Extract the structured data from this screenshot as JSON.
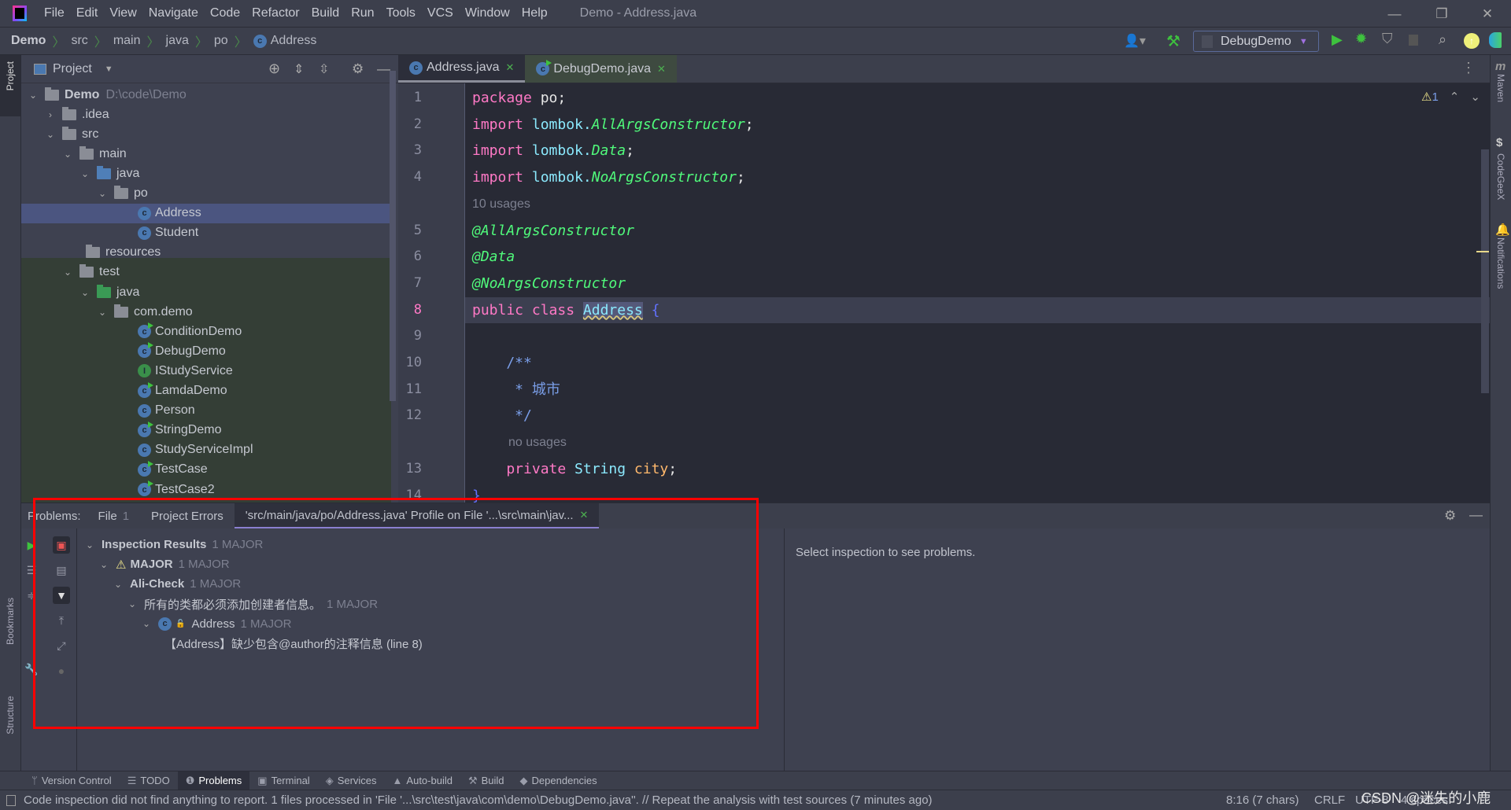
{
  "menubar": {
    "items": [
      "File",
      "Edit",
      "View",
      "Navigate",
      "Code",
      "Refactor",
      "Build",
      "Run",
      "Tools",
      "VCS",
      "Window",
      "Help"
    ],
    "window_title": "Demo - Address.java"
  },
  "breadcrumb": [
    "Demo",
    "src",
    "main",
    "java",
    "po",
    "Address"
  ],
  "toolbar": {
    "run_config": "DebugDemo"
  },
  "project": {
    "title": "Project",
    "tree": [
      {
        "label": "Demo",
        "extra": "D:\\code\\Demo",
        "depth": 0,
        "icon": "module-folder",
        "open": true,
        "bold": true
      },
      {
        "label": ".idea",
        "depth": 1,
        "icon": "folder",
        "open": false
      },
      {
        "label": "src",
        "depth": 1,
        "icon": "folder",
        "open": true
      },
      {
        "label": "main",
        "depth": 2,
        "icon": "folder",
        "open": true
      },
      {
        "label": "java",
        "depth": 3,
        "icon": "source-folder",
        "open": true
      },
      {
        "label": "po",
        "depth": 4,
        "icon": "package",
        "open": true
      },
      {
        "label": "Address",
        "depth": 5,
        "icon": "class",
        "selected": true
      },
      {
        "label": "Student",
        "depth": 5,
        "icon": "class"
      },
      {
        "label": "resources",
        "depth": 3,
        "icon": "resources-folder"
      },
      {
        "label": "test",
        "depth": 2,
        "icon": "folder",
        "open": true
      },
      {
        "label": "java",
        "depth": 3,
        "icon": "test-folder",
        "open": true
      },
      {
        "label": "com.demo",
        "depth": 4,
        "icon": "package",
        "open": true
      },
      {
        "label": "ConditionDemo",
        "depth": 5,
        "icon": "class-run"
      },
      {
        "label": "DebugDemo",
        "depth": 5,
        "icon": "class-run"
      },
      {
        "label": "IStudyService",
        "depth": 5,
        "icon": "interface"
      },
      {
        "label": "LamdaDemo",
        "depth": 5,
        "icon": "class-run"
      },
      {
        "label": "Person",
        "depth": 5,
        "icon": "class"
      },
      {
        "label": "StringDemo",
        "depth": 5,
        "icon": "class-run"
      },
      {
        "label": "StudyServiceImpl",
        "depth": 5,
        "icon": "class"
      },
      {
        "label": "TestCase",
        "depth": 5,
        "icon": "class-run"
      },
      {
        "label": "TestCase2",
        "depth": 5,
        "icon": "class-run"
      }
    ]
  },
  "editor": {
    "tabs": [
      {
        "label": "Address.java",
        "active": true
      },
      {
        "label": "DebugDemo.java"
      }
    ],
    "warnings": "1",
    "lines": [
      {
        "n": "1",
        "tokens": [
          [
            "package ",
            "kw"
          ],
          [
            "po;",
            ""
          ]
        ]
      },
      {
        "n": "2",
        "tokens": [
          [
            "import ",
            "kw"
          ],
          [
            "lombok.",
            "pkg"
          ],
          [
            "AllArgsConstructor",
            "ital"
          ],
          [
            ";",
            ""
          ]
        ]
      },
      {
        "n": "3",
        "tokens": [
          [
            "import ",
            "kw"
          ],
          [
            "lombok.",
            "pkg"
          ],
          [
            "Data",
            "ital"
          ],
          [
            ";",
            ""
          ]
        ]
      },
      {
        "n": "4",
        "tokens": [
          [
            "import ",
            "kw"
          ],
          [
            "lombok.",
            "pkg"
          ],
          [
            "NoArgsConstructor",
            "ital"
          ],
          [
            ";",
            ""
          ]
        ]
      },
      {
        "hint": "10 usages"
      },
      {
        "n": "5",
        "tokens": [
          [
            "@AllArgsConstructor",
            "ann"
          ]
        ]
      },
      {
        "n": "6",
        "tokens": [
          [
            "@Data",
            "ann"
          ]
        ]
      },
      {
        "n": "7",
        "tokens": [
          [
            "@NoArgsConstructor",
            "ann"
          ]
        ]
      },
      {
        "n": "8",
        "current": true,
        "tokens": [
          [
            "public class ",
            "kw"
          ],
          [
            "Address",
            "cls"
          ],
          [
            " {",
            "brace"
          ]
        ]
      },
      {
        "n": "9",
        "tokens": []
      },
      {
        "n": "10",
        "tokens": [
          [
            "    /**",
            "doc"
          ]
        ]
      },
      {
        "n": "11",
        "tokens": [
          [
            "     * 城市",
            "doc"
          ]
        ]
      },
      {
        "n": "12",
        "tokens": [
          [
            "     */",
            "doc"
          ]
        ]
      },
      {
        "hint": "no usages",
        "indent": true
      },
      {
        "n": "13",
        "tokens": [
          [
            "    private ",
            "kw"
          ],
          [
            "String ",
            "typ"
          ],
          [
            "city",
            "fld"
          ],
          [
            ";",
            ""
          ]
        ]
      },
      {
        "n": "14",
        "tokens": [
          [
            "}",
            "brace"
          ]
        ]
      }
    ]
  },
  "right_strip": [
    "Maven",
    "CodeGeeX",
    "Notifications"
  ],
  "left_strip": [
    "Project",
    "Bookmarks",
    "Structure"
  ],
  "problems": {
    "label": "Problems:",
    "tabs": [
      {
        "label": "File",
        "count": "1"
      },
      {
        "label": "Project Errors"
      },
      {
        "label": "'src/main/java/po/Address.java' Profile on File '...\\src\\main\\jav...",
        "active": true
      }
    ],
    "tree": [
      {
        "label": "Inspection Results",
        "count": "1 MAJOR",
        "bold": true
      },
      {
        "label": "MAJOR",
        "count": "1 MAJOR",
        "bold": true,
        "icon": "warning"
      },
      {
        "label": "Ali-Check",
        "count": "1 MAJOR",
        "bold": true
      },
      {
        "label": "所有的类都必须添加创建者信息。",
        "count": "1 MAJOR"
      },
      {
        "label": "Address",
        "count": "1 MAJOR",
        "icon": "class"
      },
      {
        "label": "【Address】缺少包含@author的注释信息 (line 8)",
        "leaf": true
      }
    ],
    "detail": "Select inspection to see problems."
  },
  "toolwindows": [
    {
      "label": "Version Control",
      "icon": "branch-icon"
    },
    {
      "label": "TODO",
      "icon": "list-icon"
    },
    {
      "label": "Problems",
      "icon": "info-icon",
      "active": true
    },
    {
      "label": "Terminal",
      "icon": "terminal-icon"
    },
    {
      "label": "Services",
      "icon": "services-icon"
    },
    {
      "label": "Auto-build",
      "icon": "build-icon"
    },
    {
      "label": "Build",
      "icon": "hammer-icon"
    },
    {
      "label": "Dependencies",
      "icon": "deps-icon"
    }
  ],
  "status": {
    "message": "Code inspection did not find anything to report. 1 files processed in 'File '...\\src\\test\\java\\com\\demo\\DebugDemo.java''. // Repeat the analysis with test sources (7 minutes ago)",
    "position": "8:16 (7 chars)",
    "line_sep": "CRLF",
    "encoding": "UTF-8",
    "indent": "4 spaces",
    "watermark": "CSDN @迷失的小鹿"
  }
}
